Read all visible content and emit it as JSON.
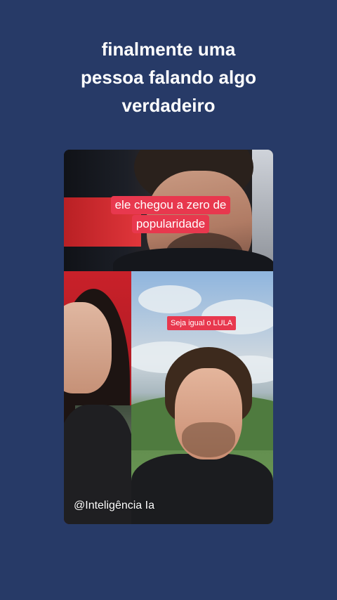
{
  "headline": {
    "lines": [
      "finalmente uma",
      "pessoa falando algo",
      "verdadeiro"
    ]
  },
  "video": {
    "top_caption": {
      "lines": [
        "ele chegou a zero de",
        "popularidade"
      ]
    },
    "bottom_caption": "Seja igual o LULA",
    "watermark": "@Inteligência Ia"
  },
  "colors": {
    "background": "#273a67",
    "caption_bg": "#e8384e",
    "text": "#ffffff"
  }
}
